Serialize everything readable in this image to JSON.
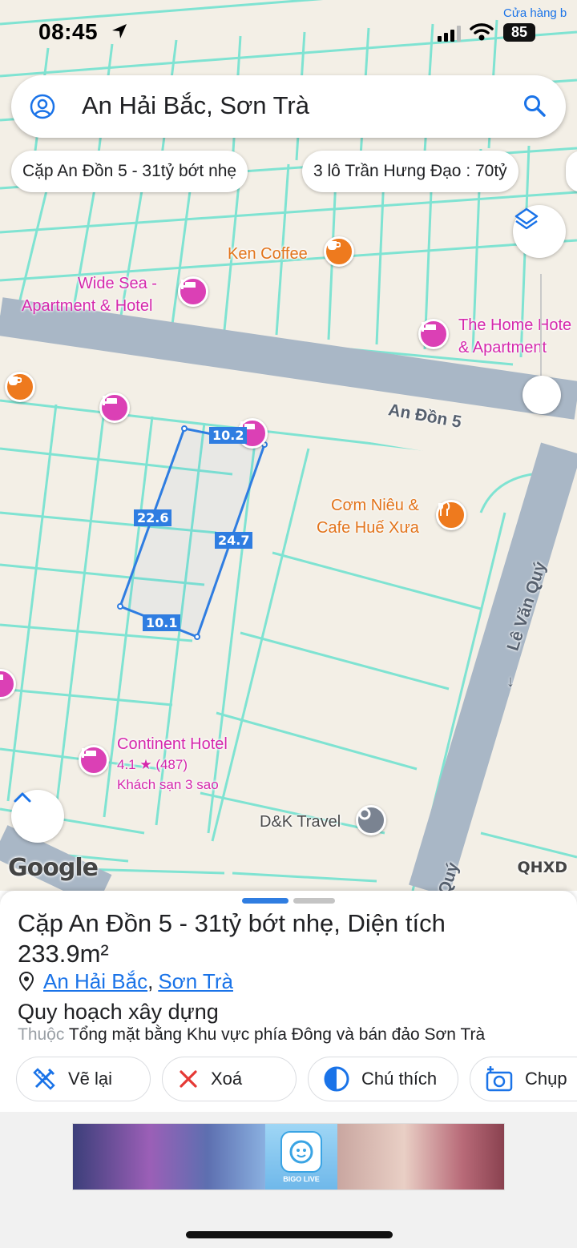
{
  "status_bar": {
    "time": "08:45",
    "battery": "85",
    "corner_text": "Cửa hàng b"
  },
  "search": {
    "query": "An Hải Bắc, Sơn Trà"
  },
  "chips": [
    "Cặp An Đồn 5 - 31tỷ bớt nhẹ",
    "3 lô Trần Hưng Đạo : 70tỷ"
  ],
  "map": {
    "pois": {
      "ken_coffee": "Ken Coffee",
      "wide_sea_1": "Wide Sea -",
      "wide_sea_2": "Apartment & Hotel",
      "home_hotel_1": "The Home Hote",
      "home_hotel_2": "& Apartment",
      "com_nieu_1": "Cơm Niêu &",
      "com_nieu_2": "Cafe Huế Xưa",
      "continent_name": "Continent Hotel",
      "continent_rating": "4.1 ★ (487)",
      "continent_class": "Khách sạn 3 sao",
      "dk_travel": "D&K Travel"
    },
    "roads": {
      "an_don_5": "An Đồn 5",
      "le_van_quy": "Lê Văn Quý",
      "quy_partial": "Quý"
    },
    "measurements": {
      "top": "10.2",
      "left": "22.6",
      "right": "24.7",
      "bottom": "10.1"
    },
    "attribution": "Google",
    "layer_badge": "QHXD"
  },
  "sheet": {
    "title": "Cặp An Đồn 5 - 31tỷ bớt nhẹ,",
    "title_suffix": "Diện tích",
    "area": "233.9m²",
    "location_ward": "An Hải Bắc",
    "location_district": "Sơn Trà",
    "plan_title": "Quy hoạch xây dựng",
    "plan_sub_prefix": "Thuộc",
    "plan_sub": "Tổng mặt bằng Khu vực phía Đông và bán đảo Sơn Trà",
    "actions": [
      "Vẽ lại",
      "Xoá",
      "Chú thích",
      "Chụp"
    ]
  },
  "ad": {
    "brand": "BIGO LIVE"
  }
}
